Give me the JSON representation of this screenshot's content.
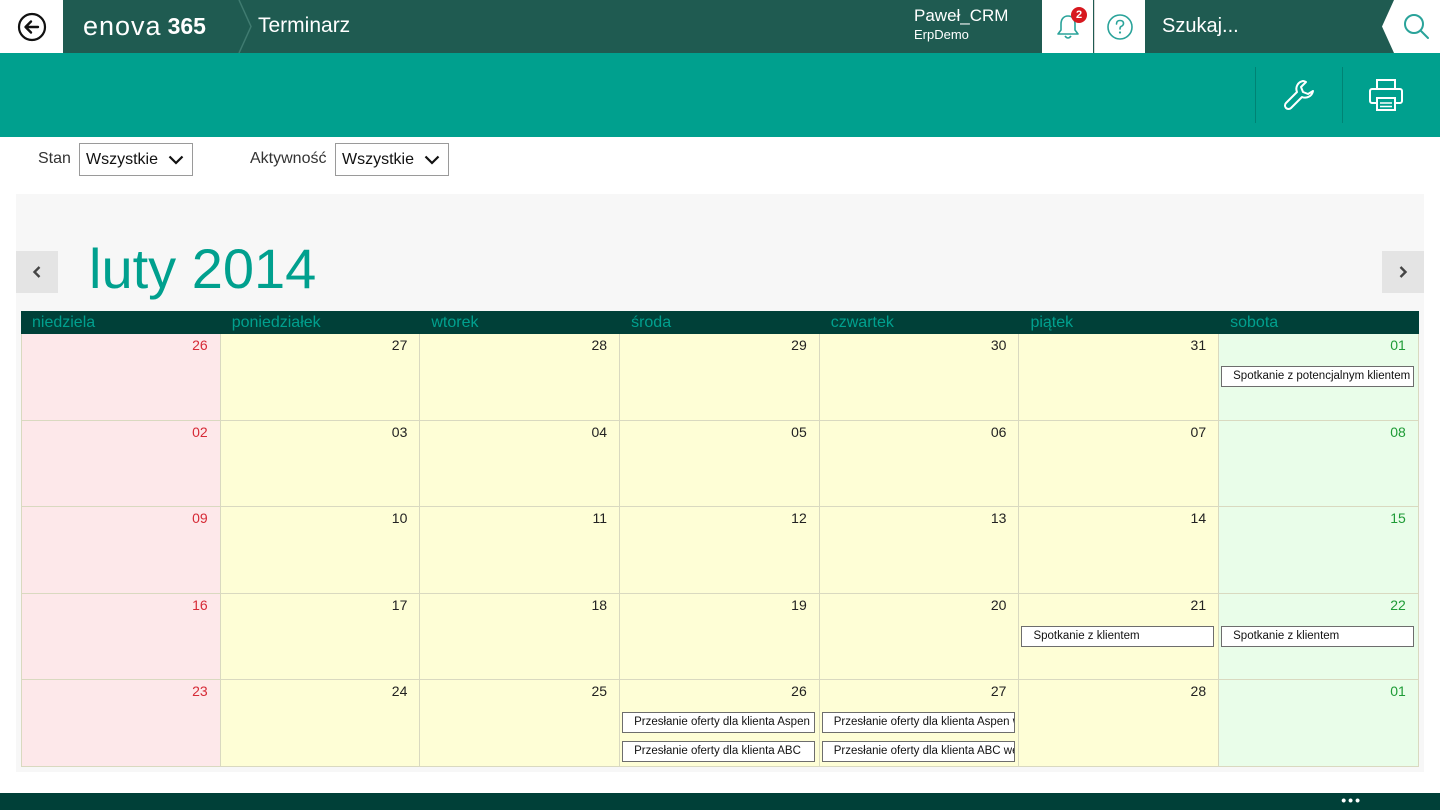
{
  "header": {
    "brand_text": "enova",
    "brand_suffix": "365",
    "title": "Terminarz",
    "user_name": "Paweł_CRM",
    "user_db": "ErpDemo",
    "notification_count": "2",
    "search_placeholder": "Szukaj..."
  },
  "toolbar": {
    "icons": [
      "wrench-icon",
      "printer-icon"
    ]
  },
  "filters": {
    "stan_label": "Stan",
    "stan_value": "Wszystkie",
    "aktywnosc_label": "Aktywność",
    "aktywnosc_value": "Wszystkie"
  },
  "calendar": {
    "month_title": "luty 2014",
    "days": [
      "niedziela",
      "poniedziałek",
      "wtorek",
      "środa",
      "czwartek",
      "piątek",
      "sobota"
    ],
    "weeks": [
      [
        {
          "n": "26",
          "events": []
        },
        {
          "n": "27",
          "events": []
        },
        {
          "n": "28",
          "events": []
        },
        {
          "n": "29",
          "events": []
        },
        {
          "n": "30",
          "events": []
        },
        {
          "n": "31",
          "events": []
        },
        {
          "n": "01",
          "events": [
            "Spotkanie z potencjalnym klientem"
          ]
        }
      ],
      [
        {
          "n": "02",
          "events": []
        },
        {
          "n": "03",
          "events": []
        },
        {
          "n": "04",
          "events": []
        },
        {
          "n": "05",
          "events": []
        },
        {
          "n": "06",
          "events": []
        },
        {
          "n": "07",
          "events": []
        },
        {
          "n": "08",
          "events": []
        }
      ],
      [
        {
          "n": "09",
          "events": []
        },
        {
          "n": "10",
          "events": []
        },
        {
          "n": "11",
          "events": []
        },
        {
          "n": "12",
          "events": []
        },
        {
          "n": "13",
          "events": []
        },
        {
          "n": "14",
          "events": []
        },
        {
          "n": "15",
          "events": []
        }
      ],
      [
        {
          "n": "16",
          "events": []
        },
        {
          "n": "17",
          "events": []
        },
        {
          "n": "18",
          "events": []
        },
        {
          "n": "19",
          "events": []
        },
        {
          "n": "20",
          "events": []
        },
        {
          "n": "21",
          "events": [
            "Spotkanie z klientem"
          ]
        },
        {
          "n": "22",
          "events": [
            "Spotkanie z klientem"
          ]
        }
      ],
      [
        {
          "n": "23",
          "events": []
        },
        {
          "n": "24",
          "events": []
        },
        {
          "n": "25",
          "events": []
        },
        {
          "n": "26",
          "events": [
            "Przesłanie oferty dla klienta Aspen",
            "Przesłanie oferty dla klienta ABC"
          ]
        },
        {
          "n": "27",
          "events": [
            "Przesłanie oferty dla klienta Aspen w",
            "Przesłanie oferty dla klienta ABC we"
          ]
        },
        {
          "n": "28",
          "events": []
        },
        {
          "n": "01",
          "events": []
        }
      ]
    ]
  },
  "colors": {
    "header_dark": "#1f5b51",
    "teal": "#00a08e",
    "day_header_bg": "#004038",
    "sunday_bg": "#fde8ea",
    "weekday_bg": "#fefed6",
    "saturday_bg": "#e9fde9"
  },
  "status": {
    "more_label": "•••"
  }
}
